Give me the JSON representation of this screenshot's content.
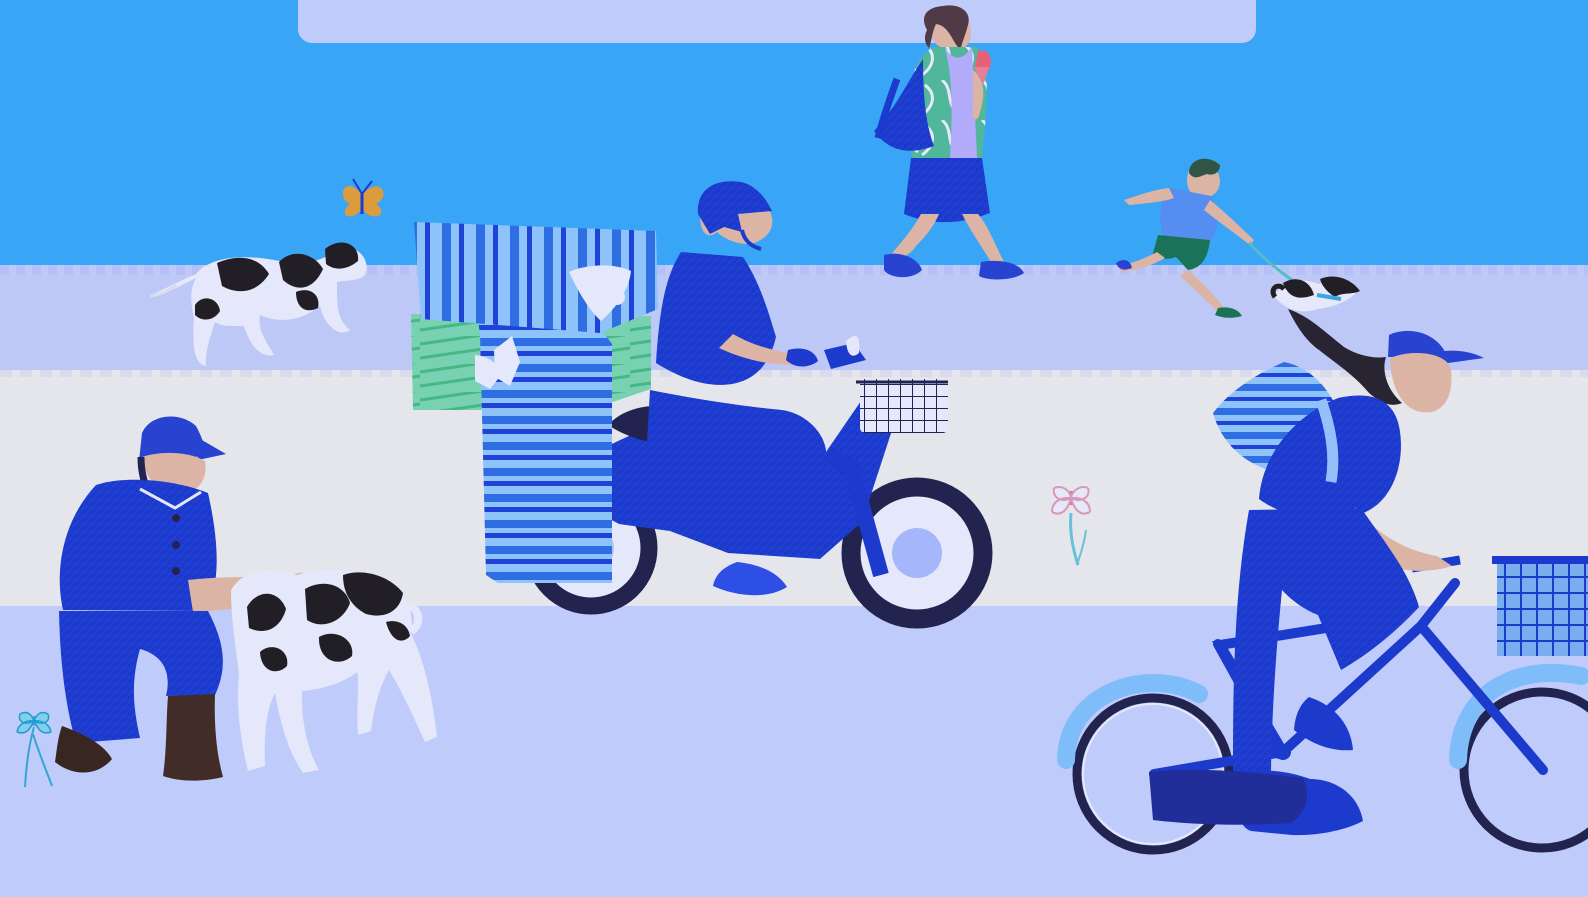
{
  "scene": {
    "palette": {
      "sky": "#3fb6fb",
      "sidewalk": "#d4dcfb",
      "road_light": "#fffdf1",
      "road_lavender": "#d6e0ff",
      "uniform_blue": "#1f3fd0",
      "dark_navy": "#26264f",
      "skin": "#f6c6a8",
      "milk_stripe_blue": "#3479e7",
      "milk_light_blue": "#9fd6ff",
      "milk_green": "#79e2aa",
      "basket_white": "#ffffff",
      "cow_black": "#262126",
      "flower_pink": "#f3a6bd",
      "flower_aqua": "#72d5de",
      "butterfly_orange": "#f7ac3f"
    },
    "icons": [
      "butterfly-icon",
      "cow-icon",
      "calf-icon",
      "milk-carton-icon",
      "delivery-scooter-icon",
      "bicycle-icon",
      "dog-icon",
      "flower-icon"
    ]
  }
}
